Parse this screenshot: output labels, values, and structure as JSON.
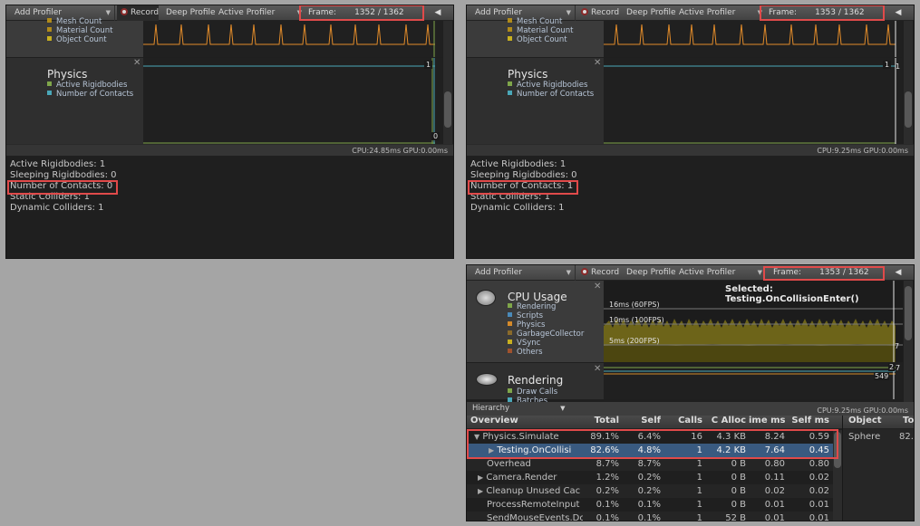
{
  "toolbar": {
    "add_profiler": "Add Profiler",
    "record": "Record",
    "deep_profile": "Deep Profile",
    "active_profiler": "Active Profiler",
    "frame_label": "Frame:",
    "prev_icon": "◀"
  },
  "panel1": {
    "frame_value": "1352 / 1362",
    "rendering_legend": [
      "Mesh Count",
      "Material Count",
      "Object Count"
    ],
    "physics_title": "Physics",
    "physics_legend": [
      "Active Rigidbodies",
      "Number of Contacts"
    ],
    "graph_label_top": "1",
    "graph_label_bottom": "0",
    "status": "CPU:24.85ms   GPU:0.00ms",
    "details": [
      "Active Rigidbodies: 1",
      "Sleeping Rigidbodies: 0",
      "Number of Contacts: 0",
      "Static Colliders: 1",
      "Dynamic Colliders: 1"
    ]
  },
  "panel2": {
    "frame_value": "1353 / 1362",
    "rendering_legend": [
      "Mesh Count",
      "Material Count",
      "Object Count"
    ],
    "physics_title": "Physics",
    "physics_legend": [
      "Active Rigidbodies",
      "Number of Contacts"
    ],
    "graph_label_top": "1",
    "graph_label_top2": "1",
    "status": "CPU:9.25ms   GPU:0.00ms",
    "details": [
      "Active Rigidbodies: 1",
      "Sleeping Rigidbodies: 0",
      "Number of Contacts: 1",
      "Static Colliders: 1",
      "Dynamic Colliders: 1"
    ]
  },
  "panel3": {
    "frame_value": "1353 / 1362",
    "selected_label": "Selected: Testing.OnCollisionEnter()",
    "cpu_title": "CPU Usage",
    "cpu_legend": [
      "Rendering",
      "Scripts",
      "Physics",
      "GarbageCollector",
      "VSync",
      "Others"
    ],
    "rendering_title": "Rendering",
    "rendering_legend": [
      "Draw Calls",
      "Batches"
    ],
    "line_16ms": "16ms (60FPS)",
    "line_10ms": "10ms (100FPS)",
    "line_5ms": "5ms (200FPS)",
    "graph_label_7a": "7",
    "graph_label_2": "2",
    "graph_label_7b": "7",
    "graph_label_549": "549",
    "hierarchy": "Hierarchy",
    "status": "CPU:9.25ms   GPU:0.00ms",
    "columns": [
      "Overview",
      "Total",
      "Self",
      "Calls",
      "GC Alloc",
      "Time ms",
      "Self ms"
    ],
    "columns_visible": [
      "Overview",
      "Total",
      "Self",
      "Calls",
      "C Alloc",
      "ime ms",
      "Self ms"
    ],
    "object_columns": [
      "Object",
      "To"
    ],
    "object_row": [
      "Sphere",
      "82."
    ],
    "rows": [
      {
        "tri": "▼",
        "name": "Physics.Simulate",
        "total": "89.1%",
        "self": "6.4%",
        "calls": "16",
        "gc": "4.3 KB",
        "time": "8.24",
        "selfms": "0.59"
      },
      {
        "tri": "▶",
        "name": "Testing.OnCollisi",
        "total": "82.6%",
        "self": "4.8%",
        "calls": "1",
        "gc": "4.2 KB",
        "time": "7.64",
        "selfms": "0.45"
      },
      {
        "tri": "",
        "name": "Overhead",
        "total": "8.7%",
        "self": "8.7%",
        "calls": "1",
        "gc": "0 B",
        "time": "0.80",
        "selfms": "0.80"
      },
      {
        "tri": "▶",
        "name": "Camera.Render",
        "total": "1.2%",
        "self": "0.2%",
        "calls": "1",
        "gc": "0 B",
        "time": "0.11",
        "selfms": "0.02"
      },
      {
        "tri": "▶",
        "name": "Cleanup Unused Cac",
        "total": "0.2%",
        "self": "0.2%",
        "calls": "1",
        "gc": "0 B",
        "time": "0.02",
        "selfms": "0.02"
      },
      {
        "tri": "",
        "name": "ProcessRemoteInput",
        "total": "0.1%",
        "self": "0.1%",
        "calls": "1",
        "gc": "0 B",
        "time": "0.01",
        "selfms": "0.01"
      },
      {
        "tri": "",
        "name": "SendMouseEvents.Dc",
        "total": "0.1%",
        "self": "0.1%",
        "calls": "1",
        "gc": "52 B",
        "time": "0.01",
        "selfms": "0.01"
      }
    ]
  },
  "colors": {
    "orange_line": "#e38c2a",
    "cyan_line": "#4aa7b8",
    "physics_green": "#7fa64a",
    "selection_blue": "#395a80",
    "highlight_red": "#e04a4a"
  }
}
